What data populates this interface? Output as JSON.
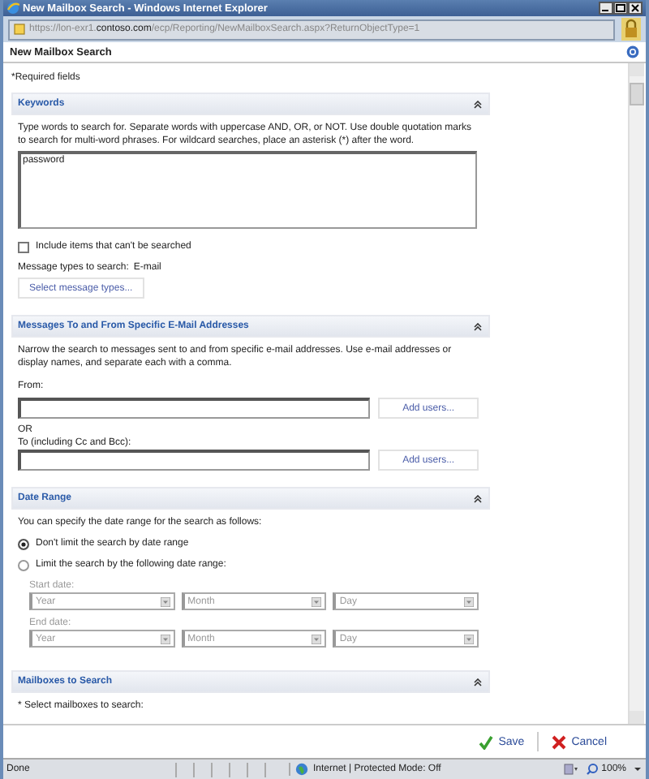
{
  "window": {
    "title": "New Mailbox Search - Windows Internet Explorer"
  },
  "address_bar": {
    "url_prefix": "https://lon-exr1.",
    "url_domain": "contoso.com",
    "url_path": "/ecp/Reporting/NewMailboxSearch.aspx?ReturnObjectType=1"
  },
  "dialog": {
    "title": "New Mailbox Search",
    "required_note": "*Required fields"
  },
  "sections": [
    {
      "kind": "keywords",
      "title": "Keywords",
      "description": "Type words to search for. Separate words with uppercase AND, OR, or NOT. Use double quotation marks to search for multi-word phrases. For wildcard searches, place an asterisk (*) after the word.",
      "keywords": "password",
      "include_unsearchable": {
        "label": "Include items that can't be searched",
        "checked": false
      },
      "message_types_label": "Message types to search:",
      "message_types_value": "E-mail",
      "select_button": "Select message types..."
    },
    {
      "kind": "addresses",
      "title": "Messages To and From Specific E-Mail Addresses",
      "description": "Narrow the search to messages sent to and from specific e-mail addresses. Use e-mail addresses or display names, and separate each with a comma.",
      "from_label": "From:",
      "from_button": "Add users...",
      "or_label": "OR",
      "to_label": "To (including Cc and Bcc):",
      "to_button": "Add users..."
    },
    {
      "kind": "date_range",
      "title": "Date Range",
      "description": "You can specify the date range for the search as follows:",
      "options": [
        {
          "label": "Don't limit the search by date range",
          "selected": true
        },
        {
          "label": "Limit the search by the following date range:",
          "selected": false
        }
      ],
      "dates_disabled": true,
      "dates": [
        {
          "label": "Start date:",
          "fields": [
            "Year",
            "Month",
            "Day"
          ]
        },
        {
          "label": "End date:",
          "fields": [
            "Year",
            "Month",
            "Day"
          ]
        }
      ]
    },
    {
      "kind": "mailboxes",
      "title": "Mailboxes to Search",
      "description": "* Select mailboxes to search:"
    }
  ],
  "footer_buttons": [
    {
      "kind": "save",
      "label": "Save"
    },
    {
      "kind": "cancel",
      "label": "Cancel"
    }
  ],
  "status_bar": {
    "text": "Done",
    "zone": "Internet | Protected Mode: Off",
    "zoom": "100%"
  }
}
